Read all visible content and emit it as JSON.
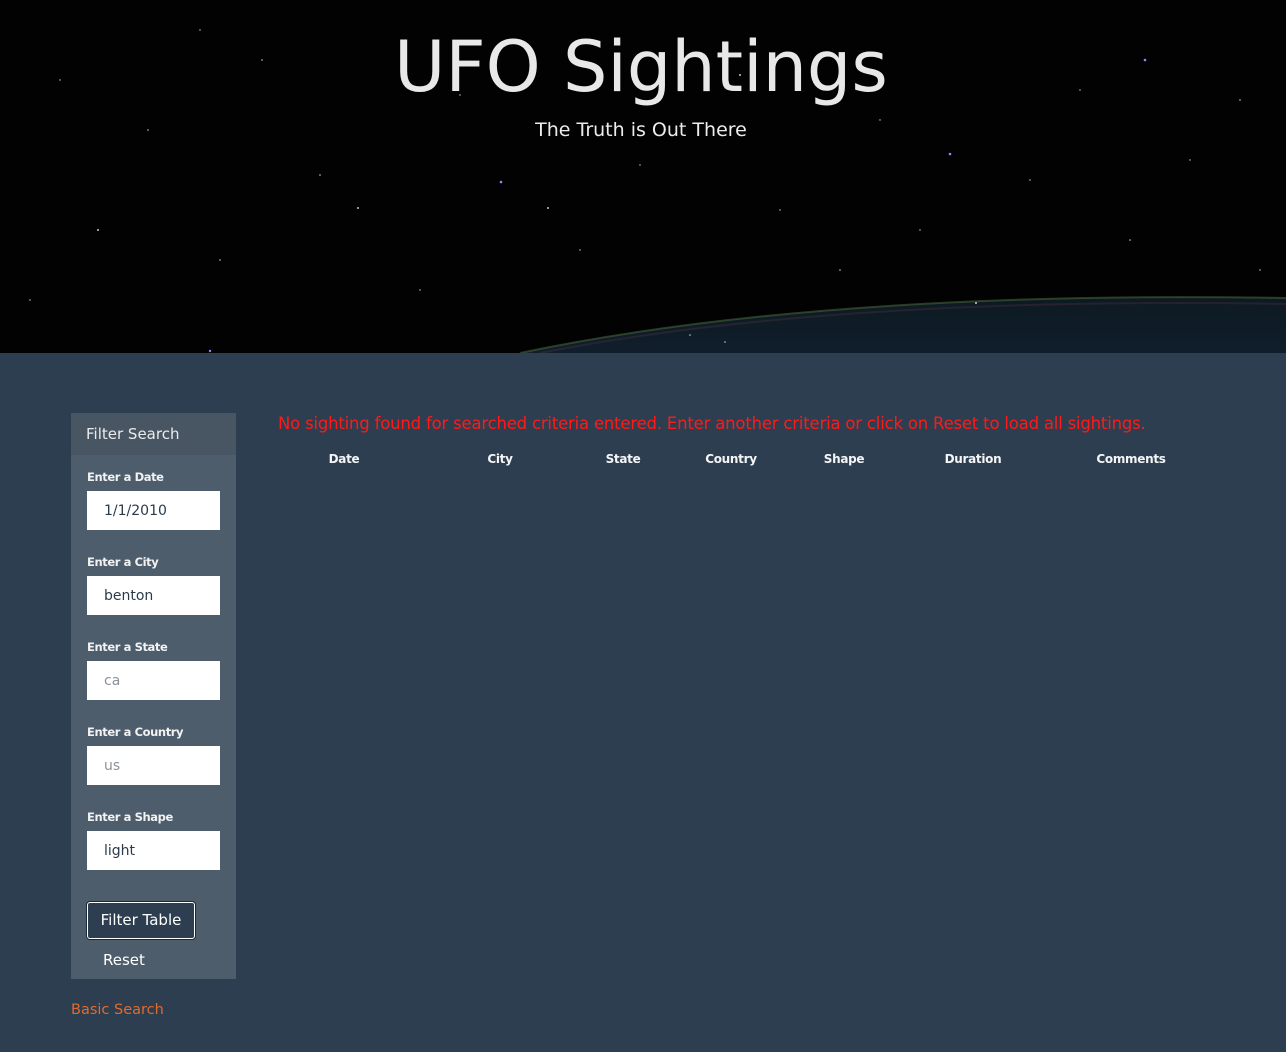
{
  "header": {
    "title": "UFO Sightings",
    "subtitle": "The Truth is Out There"
  },
  "sidebar": {
    "heading": "Filter Search",
    "fields": [
      {
        "label": "Enter a Date",
        "value": "1/1/2010",
        "placeholder": ""
      },
      {
        "label": "Enter a City",
        "value": "benton",
        "placeholder": ""
      },
      {
        "label": "Enter a State",
        "value": "",
        "placeholder": "ca"
      },
      {
        "label": "Enter a Country",
        "value": "",
        "placeholder": "us"
      },
      {
        "label": "Enter a Shape",
        "value": "light",
        "placeholder": ""
      }
    ],
    "filter_button": "Filter Table",
    "reset_button": "Reset"
  },
  "basic_search_link": "Basic Search",
  "results": {
    "message": "No sighting found for searched criteria entered. Enter another criteria or click on Reset to load all sightings.",
    "columns": [
      "Date",
      "City",
      "State",
      "Country",
      "Shape",
      "Duration",
      "Comments"
    ],
    "rows": []
  },
  "colors": {
    "page_background": "#2c3e50",
    "sidebar_background": "#4e5d6c",
    "error_text": "#ff1a1a",
    "link": "#e26a2c"
  }
}
